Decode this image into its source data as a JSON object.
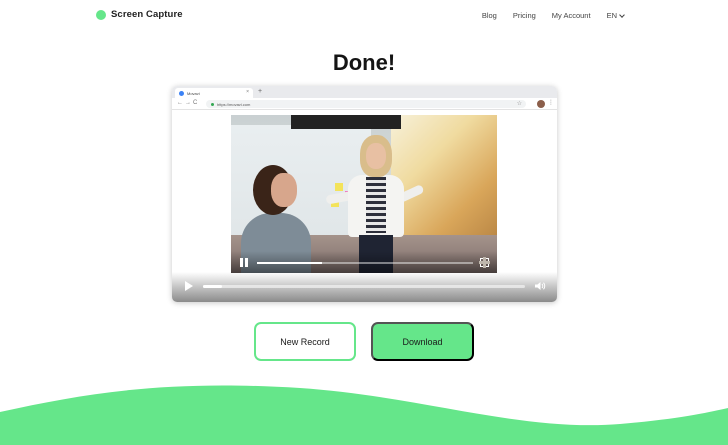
{
  "theme": {
    "accent": "#65e68a"
  },
  "brand": {
    "name": "Screen Capture",
    "logo_icon": "green-circle-icon"
  },
  "nav": {
    "items": [
      {
        "label": "Blog"
      },
      {
        "label": "Pricing"
      },
      {
        "label": "My Account"
      }
    ],
    "language": "EN"
  },
  "title": "Done!",
  "preview": {
    "browser": {
      "tab_title": "Movavi",
      "url": "https://movavi.com"
    },
    "video": {
      "progress": 0.3
    },
    "player": {
      "progress": 0.06
    }
  },
  "actions": {
    "new_record": "New Record",
    "download": "Download"
  }
}
